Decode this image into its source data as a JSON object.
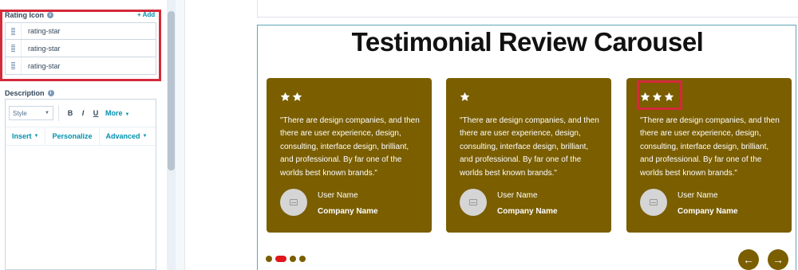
{
  "editor_panel": {
    "rating_icon": {
      "label": "Rating Icon",
      "add_label": "+ Add",
      "items": [
        "rating-star",
        "rating-star",
        "rating-star"
      ]
    },
    "description": {
      "label": "Description",
      "style_select": "Style",
      "format_buttons": [
        "B",
        "I",
        "U"
      ],
      "more_label": "More",
      "insert_label": "Insert",
      "personalize_label": "Personalize",
      "advanced_label": "Advanced"
    }
  },
  "preview": {
    "title": "Testimonial Review Carousel",
    "cards": [
      {
        "stars": 2,
        "quote": "\"There are design companies, and then there are user experience, design, consulting, interface design, brilliant, and professional. By far one of the worlds best known brands.\"",
        "user_name": "User Name",
        "company_name": "Company Name"
      },
      {
        "stars": 1,
        "quote": "\"There are design companies, and then there are user experience, design, consulting, interface design, brilliant, and professional. By far one of the worlds best known brands.\"",
        "user_name": "User Name",
        "company_name": "Company Name"
      },
      {
        "stars": 3,
        "quote": "\"There are design companies, and then there are user experience, design, consulting, interface design, brilliant, and professional. By far one of the worlds best known brands.\"",
        "user_name": "User Name",
        "company_name": "Company Name"
      }
    ],
    "pagination": {
      "total": 4,
      "active_index": 1
    },
    "nav": {
      "prev_icon": "←",
      "next_icon": "→"
    }
  },
  "colors": {
    "card_bg": "#7a5e00",
    "highlight": "#d42a3a",
    "active_dot": "#e0161c",
    "link": "#0091ae"
  }
}
